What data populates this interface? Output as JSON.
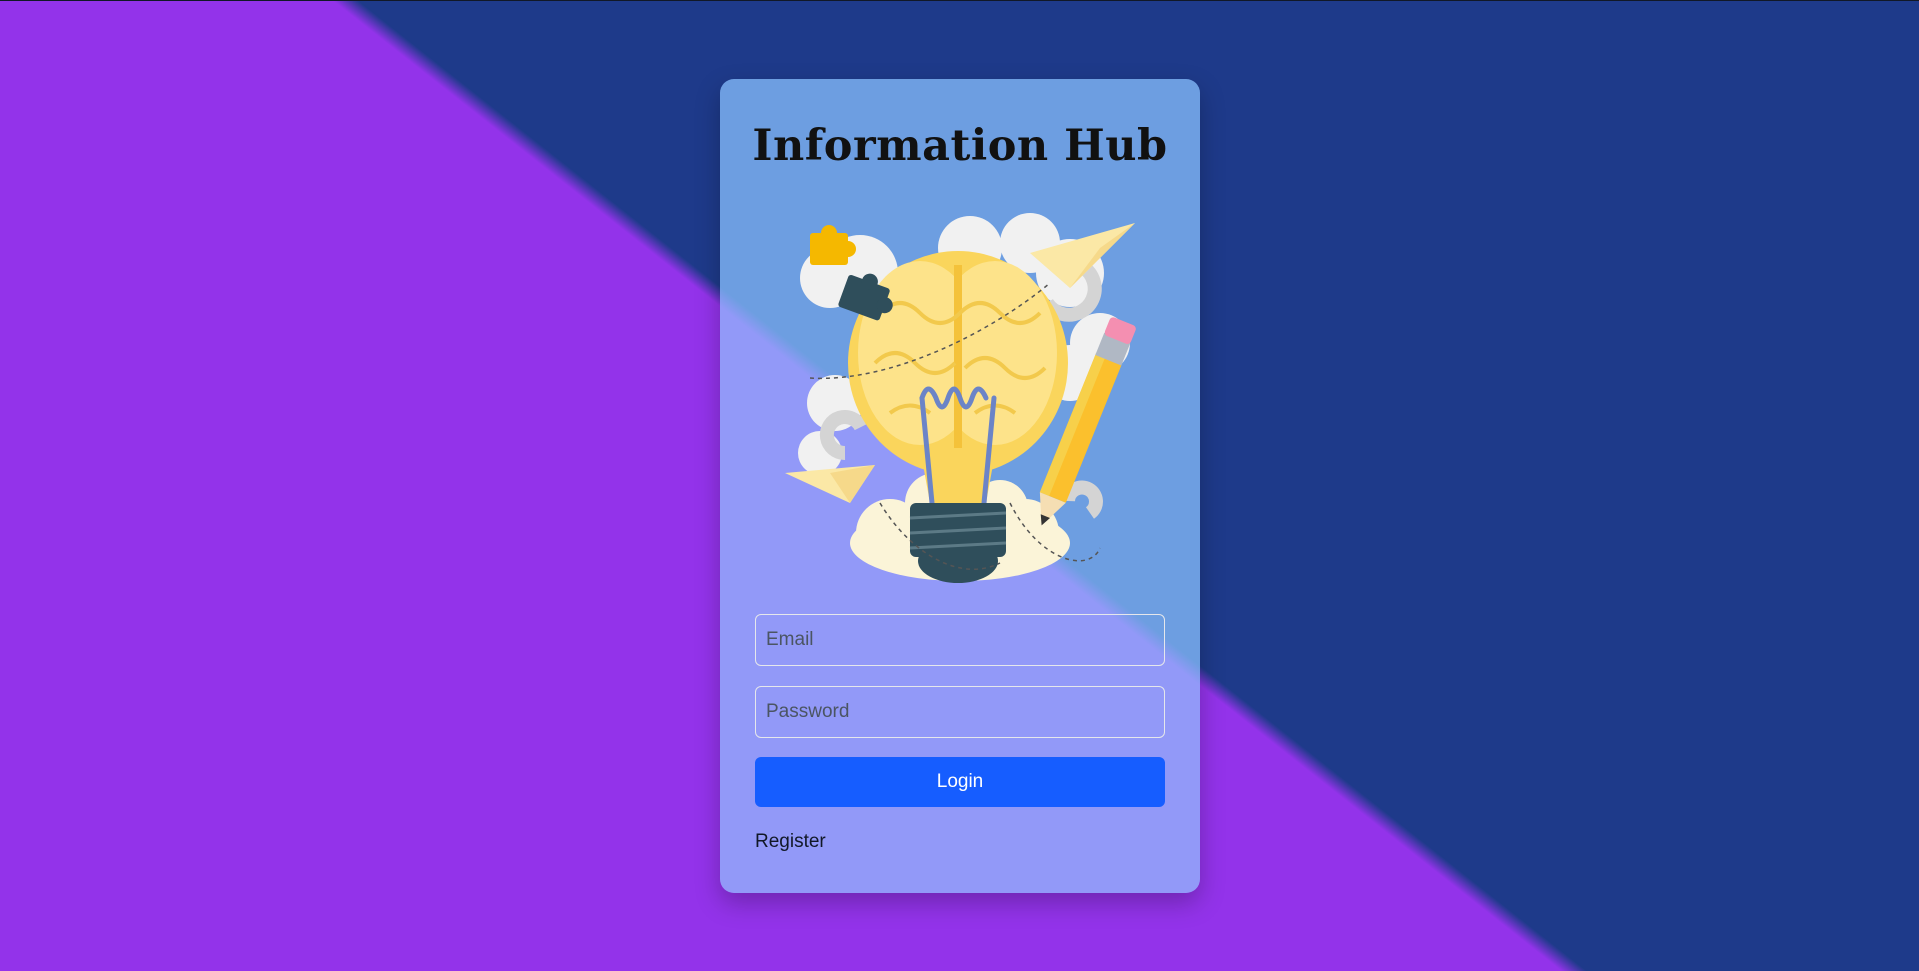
{
  "app": {
    "title": "Information Hub"
  },
  "illustration": {
    "icon": "brain-lightbulb-illustration"
  },
  "form": {
    "email_placeholder": "Email",
    "password_placeholder": "Password",
    "login_label": "Login",
    "register_label": "Register"
  },
  "colors": {
    "background_left": "#9333ea",
    "background_right": "#1e3a8a",
    "card_left": "#9299f8",
    "card_right": "#6d9ee1",
    "accent": "#165dff"
  }
}
